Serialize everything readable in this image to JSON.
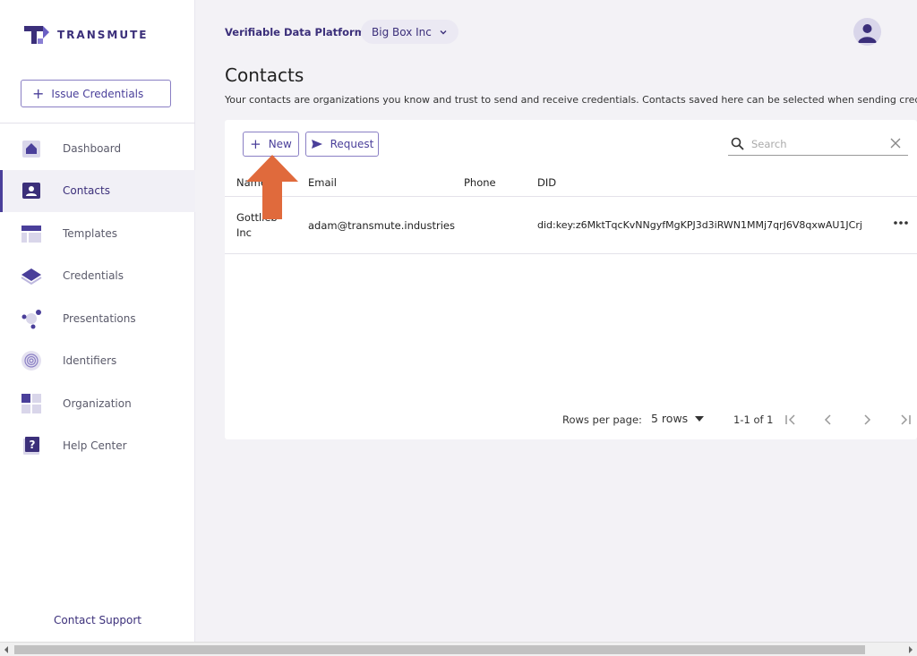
{
  "brand": {
    "name": "TRANSMUTE"
  },
  "sidebar": {
    "issue_button": "Issue Credentials",
    "items": [
      {
        "label": "Dashboard",
        "icon": "dashboard-icon",
        "active": false
      },
      {
        "label": "Contacts",
        "icon": "contacts-icon",
        "active": true
      },
      {
        "label": "Templates",
        "icon": "templates-icon",
        "active": false
      },
      {
        "label": "Credentials",
        "icon": "credentials-icon",
        "active": false
      },
      {
        "label": "Presentations",
        "icon": "presentations-icon",
        "active": false
      },
      {
        "label": "Identifiers",
        "icon": "fingerprint-icon",
        "active": false
      },
      {
        "label": "Organization",
        "icon": "organization-icon",
        "active": false
      },
      {
        "label": "Help Center",
        "icon": "help-icon",
        "active": false
      }
    ],
    "support_link": "Contact Support"
  },
  "header": {
    "platform": "Verifiable Data Platform",
    "organization": "Big Box Inc"
  },
  "page": {
    "title": "Contacts",
    "description": "Your contacts are organizations you know and trust to send and receive credentials. Contacts saved here can be selected when sending credentials."
  },
  "toolbar": {
    "new_label": "New",
    "request_label": "Request",
    "search_placeholder": "Search"
  },
  "table": {
    "columns": [
      "Name",
      "Email",
      "Phone",
      "DID"
    ],
    "rows": [
      {
        "name_line1": "Gottlieb",
        "name_line2": "Inc",
        "email": "adam@transmute.industries",
        "phone": "",
        "did": "did:key:z6MktTqcKvNNgyfMgKPJ3d3iRWN1MMj7qrJ6V8qxwAU1JCrj"
      }
    ]
  },
  "pagination": {
    "rows_label": "Rows per page:",
    "rows_value": "5 rows",
    "range": "1-1 of 1"
  },
  "colors": {
    "brand": "#3b2f7a",
    "accent": "#4a3f9a",
    "annotation": "#e06a3c"
  }
}
